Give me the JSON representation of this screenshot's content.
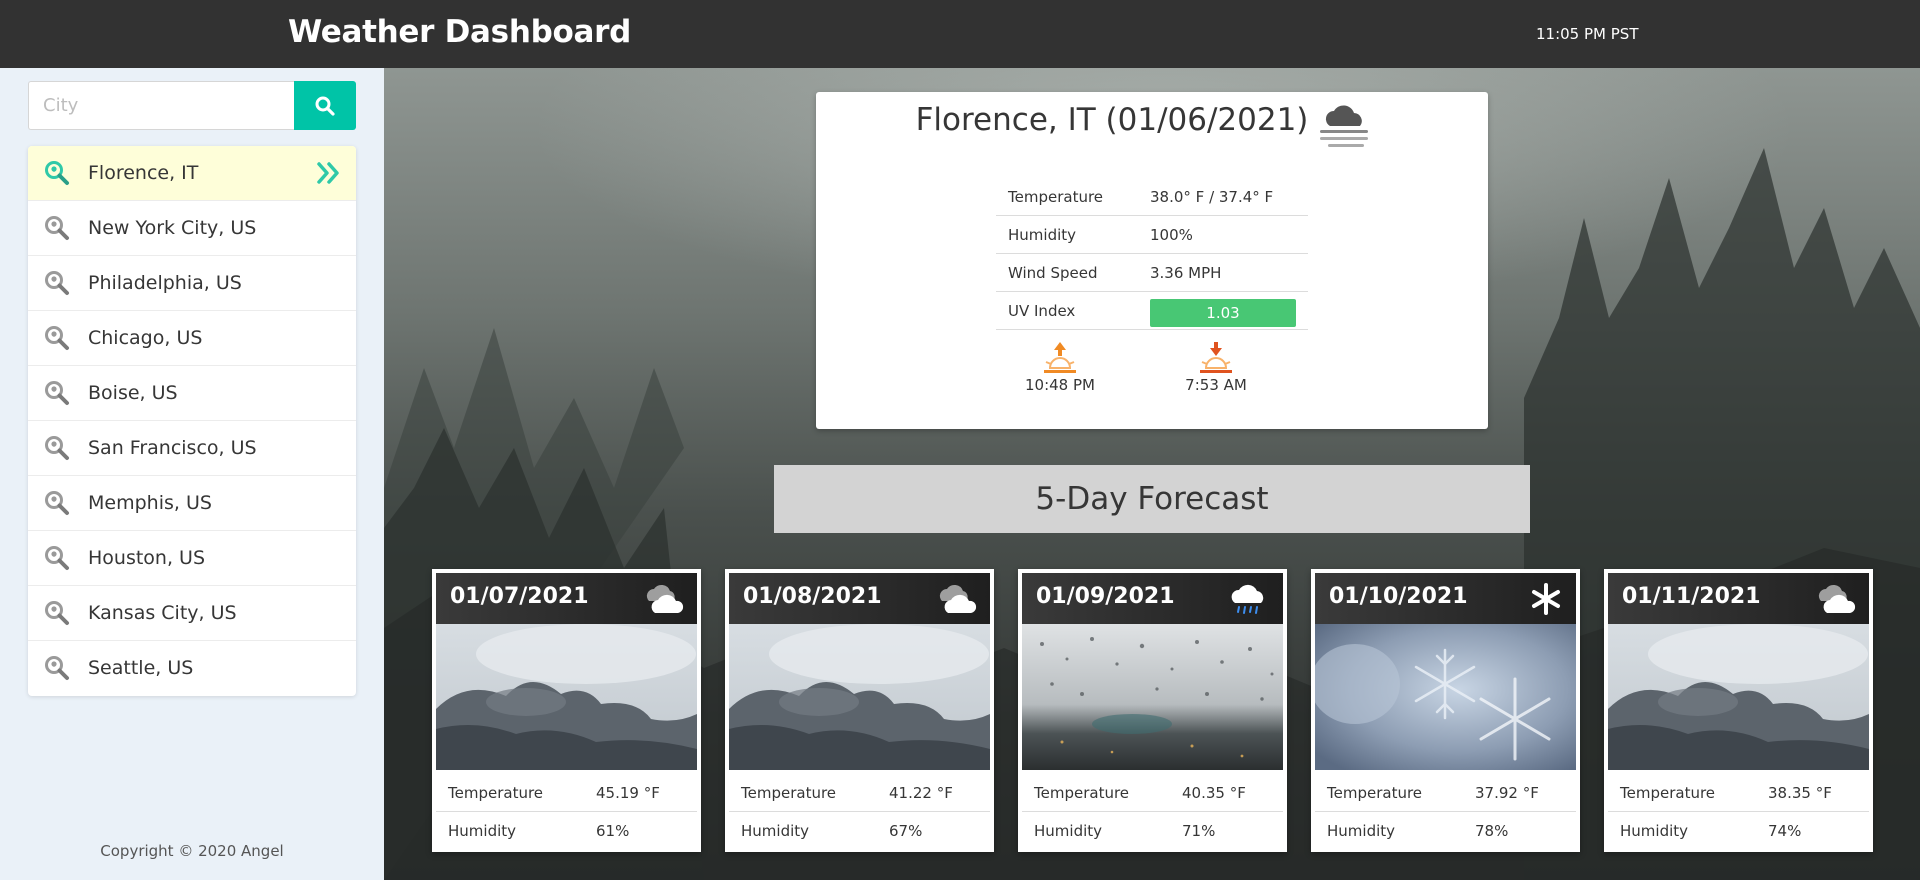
{
  "header": {
    "title": "Weather Dashboard",
    "clock": "11:05 PM PST"
  },
  "search": {
    "placeholder": "City",
    "value": ""
  },
  "cities": [
    {
      "label": "Florence, IT",
      "active": true
    },
    {
      "label": "New York City, US",
      "active": false
    },
    {
      "label": "Philadelphia, US",
      "active": false
    },
    {
      "label": "Chicago, US",
      "active": false
    },
    {
      "label": "Boise, US",
      "active": false
    },
    {
      "label": "San Francisco, US",
      "active": false
    },
    {
      "label": "Memphis, US",
      "active": false
    },
    {
      "label": "Houston, US",
      "active": false
    },
    {
      "label": "Kansas City, US",
      "active": false
    },
    {
      "label": "Seattle, US",
      "active": false
    }
  ],
  "footer": {
    "copyright": "Copyright © 2020 Angel"
  },
  "current": {
    "title": "Florence, IT (01/06/2021)",
    "icon": "mist-cloud-icon",
    "stats": [
      {
        "label": "Temperature",
        "value": "38.0° F / 37.4° F"
      },
      {
        "label": "Humidity",
        "value": "100%"
      },
      {
        "label": "Wind Speed",
        "value": "3.36 MPH"
      }
    ],
    "uv": {
      "label": "UV Index",
      "value": "1.03",
      "color": "#48c774"
    },
    "sunset": "10:48 PM",
    "sunrise": "7:53 AM"
  },
  "forecast": {
    "title": "5-Day Forecast",
    "temperature_label": "Temperature",
    "humidity_label": "Humidity",
    "days": [
      {
        "date": "01/07/2021",
        "icon": "cloud-icon",
        "image": "cloudy-sky",
        "temperature": "45.19 °F",
        "humidity": "61%"
      },
      {
        "date": "01/08/2021",
        "icon": "cloud-icon",
        "image": "cloudy-sky",
        "temperature": "41.22 °F",
        "humidity": "67%"
      },
      {
        "date": "01/09/2021",
        "icon": "rain-icon",
        "image": "rain-window",
        "temperature": "40.35 °F",
        "humidity": "71%"
      },
      {
        "date": "01/10/2021",
        "icon": "snowflake-icon",
        "image": "snowflake",
        "temperature": "37.92 °F",
        "humidity": "78%"
      },
      {
        "date": "01/11/2021",
        "icon": "cloud-icon",
        "image": "cloudy-sky",
        "temperature": "38.35 °F",
        "humidity": "74%"
      }
    ]
  },
  "colors": {
    "accent": "#00c4a7",
    "header_bg": "#323232",
    "sidebar_bg": "#eaf1f8",
    "active_row": "#fefed9",
    "sun_orange": "#f08a24"
  }
}
